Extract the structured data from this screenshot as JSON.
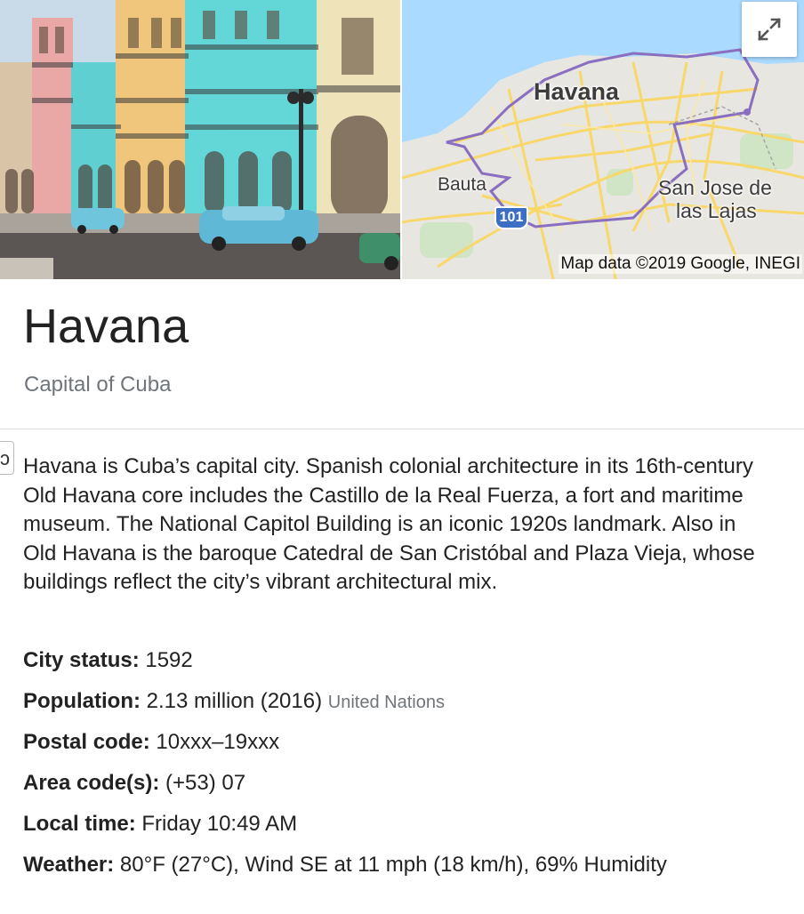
{
  "map": {
    "city_label": "Havana",
    "bauta_label": "Bauta",
    "san_jose_label_line1": "San Jose de",
    "san_jose_label_line2": "las Lajas",
    "highway_shield": "101",
    "credit": "Map data ©2019 Google, INEGI",
    "expand_icon": "expand-arrows-icon"
  },
  "entity": {
    "title": "Havana",
    "subtitle": "Capital of Cuba",
    "edge_tab_glyph": "ɔ"
  },
  "description": "Havana is Cuba’s capital city. Spanish colonial architecture in its 16th-century Old Havana core includes the Castillo de la Real Fuerza, a fort and maritime museum. The National Capitol Building is an iconic 1920s landmark. Also in Old Havana is the baroque Catedral de San Cristóbal and Plaza Vieja, whose buildings reflect the city’s vibrant architectural mix.",
  "facts": [
    {
      "label": "City status:",
      "value": "1592",
      "source": ""
    },
    {
      "label": "Population:",
      "value": "2.13 million (2016)",
      "source": "United Nations"
    },
    {
      "label": "Postal code:",
      "value": "10xxx–19xxx",
      "source": ""
    },
    {
      "label": "Area code(s):",
      "value": "(+53) 07",
      "source": ""
    },
    {
      "label": "Local time:",
      "value": "Friday 10:49 AM",
      "source": ""
    },
    {
      "label": "Weather:",
      "value": "80°F (27°C), Wind SE at 11 mph (18 km/h), 69% Humidity",
      "source": ""
    }
  ],
  "colors": {
    "map_land": "#e5e3df",
    "map_water": "#aadaff",
    "map_road": "#f8d86b",
    "boundary": "#8a6fc0",
    "highway_shield": "#3a6fc4",
    "secondary_text": "#70757a"
  }
}
